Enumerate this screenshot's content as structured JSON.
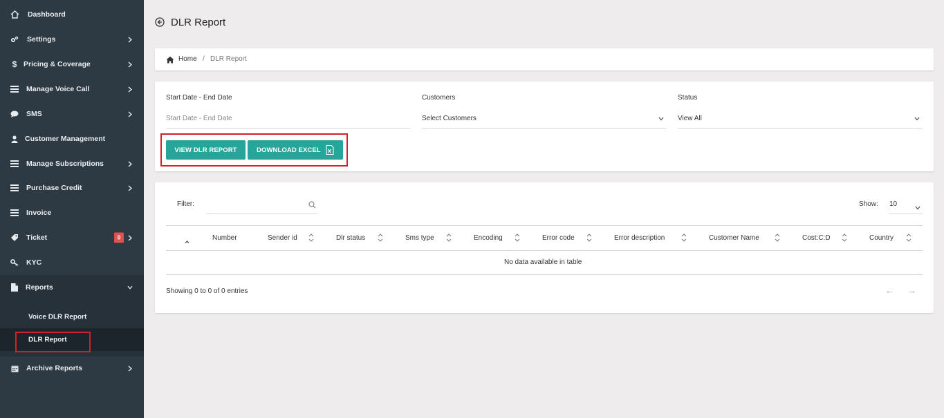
{
  "sidebar": {
    "items": [
      {
        "label": "Dashboard",
        "icon": "home-icon"
      },
      {
        "label": "Settings",
        "icon": "gears-icon"
      },
      {
        "label": "Pricing & Coverage",
        "icon": "dollar-icon"
      },
      {
        "label": "Manage Voice Call",
        "icon": "list-icon"
      },
      {
        "label": "SMS",
        "icon": "chat-icon"
      },
      {
        "label": "Customer Management",
        "icon": "user-icon"
      },
      {
        "label": "Manage Subscriptions",
        "icon": "list-icon"
      },
      {
        "label": "Purchase Credit",
        "icon": "list-icon"
      },
      {
        "label": "Invoice",
        "icon": "list-icon"
      },
      {
        "label": "Ticket",
        "icon": "tag-icon",
        "badge": "0"
      },
      {
        "label": "KYC",
        "icon": "key-icon"
      },
      {
        "label": "Reports",
        "icon": "file-icon"
      },
      {
        "label": "Archive Reports",
        "icon": "calendar-icon"
      }
    ],
    "reports_sub": [
      {
        "label": "Voice DLR Report"
      },
      {
        "label": "DLR Report"
      }
    ]
  },
  "page": {
    "title": "DLR Report"
  },
  "breadcrumb": {
    "home": "Home",
    "sep": "/",
    "current": "DLR Report"
  },
  "filters": {
    "date_label": "Start Date - End Date",
    "date_placeholder": "Start Date - End Date",
    "customers_label": "Customers",
    "customers_value": "Select Customers",
    "status_label": "Status",
    "status_value": "View All"
  },
  "buttons": {
    "view": "VIEW DLR REPORT",
    "download": "DOWNLOAD EXCEL"
  },
  "table": {
    "filter_label": "Filter:",
    "show_label": "Show:",
    "show_value": "10",
    "columns": [
      "Number",
      "Sender id",
      "Dlr status",
      "Sms type",
      "Encoding",
      "Error code",
      "Error description",
      "Customer Name",
      "Cost:C:D",
      "Country"
    ],
    "empty_message": "No data available in table",
    "info": "Showing 0 to 0 of 0 entries",
    "prev": "←",
    "next": "→"
  },
  "colors": {
    "sidebar_bg": "#2e3a43",
    "accent": "#26a69a",
    "highlight_border": "#d21f2a",
    "badge": "#e05252"
  }
}
